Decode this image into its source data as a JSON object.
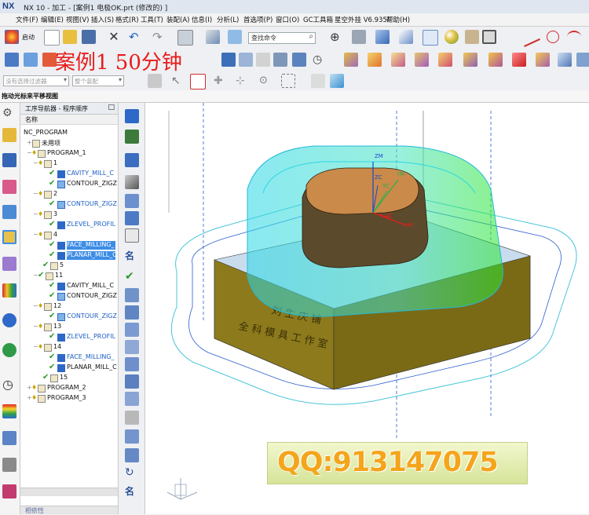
{
  "window": {
    "logo": "NX",
    "title": "NX 10 - 加工 - [案例1  电极OK.prt  (修改的) ]"
  },
  "menu": [
    "文件(F)",
    "编辑(E)",
    "视图(V)",
    "插入(S)",
    "格式(R)",
    "工具(T)",
    "装配(A)",
    "信息(I)",
    "分析(L)",
    "首选项(P)",
    "窗口(O)",
    "GC工具箱",
    "星空外挂 V6.935F",
    "帮助(H)"
  ],
  "toolbar": {
    "start_label": "启动",
    "command_search_placeholder": "查找命令",
    "filter_placeholder": "没有选择过滤器",
    "assembly_placeholder": "整个装配"
  },
  "overlay": {
    "case_text": "案例1   50分钟",
    "qq_text": "QQ:913147075"
  },
  "statusline": "拖动光标来平移视图",
  "navigator": {
    "title": "工序导航器 - 程序顺序",
    "column": "名称",
    "footer": "相依性",
    "rows": [
      {
        "label": "NC_PROGRAM"
      },
      {
        "label": "未用项"
      },
      {
        "label": "PROGRAM_1"
      },
      {
        "label": "1"
      },
      {
        "label": "CAVITY_MILL_C"
      },
      {
        "label": "CONTOUR_ZIGZ"
      },
      {
        "label": "2"
      },
      {
        "label": "CONTOUR_ZIGZ"
      },
      {
        "label": "3"
      },
      {
        "label": "ZLEVEL_PROFIL"
      },
      {
        "label": "4"
      },
      {
        "label": "FACE_MILLING_"
      },
      {
        "label": "PLANAR_MILL_C"
      },
      {
        "label": "5"
      },
      {
        "label": "11"
      },
      {
        "label": "CAVITY_MILL_C"
      },
      {
        "label": "CONTOUR_ZIGZ"
      },
      {
        "label": "12"
      },
      {
        "label": "CONTOUR_ZIGZ"
      },
      {
        "label": "13"
      },
      {
        "label": "ZLEVEL_PROFIL"
      },
      {
        "label": "14"
      },
      {
        "label": "FACE_MILLING_"
      },
      {
        "label": "PLANAR_MILL_C"
      },
      {
        "label": "15"
      },
      {
        "label": "PROGRAM_2"
      },
      {
        "label": "PROGRAM_3"
      }
    ]
  },
  "model": {
    "engraving_line1": "刘 生 庆 铺",
    "engraving_line2": "全 科 模 具 工 作 室",
    "axes": {
      "zm": "ZM",
      "ym": "YM",
      "xm": "XM",
      "zc": "ZC",
      "yc": "YC",
      "xc": "XC"
    }
  },
  "colors": {
    "toolpath_cyan": "#29d7e6",
    "toolpath_green": "#28e62a",
    "electrode_top": "#c98a4a",
    "base_body": "#8c7a1c",
    "base_top": "#c8dcee",
    "accent_red": "#e81c1c",
    "select_blue": "#3d8de6"
  }
}
